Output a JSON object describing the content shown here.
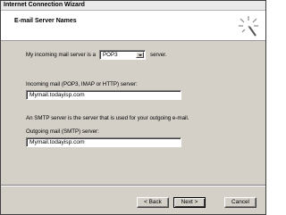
{
  "window": {
    "title": "Internet Connection Wizard"
  },
  "header": {
    "heading": "E-mail Server Names",
    "icon": "wizard-wand-icon"
  },
  "incoming": {
    "prefix_label": "My incoming mail server is a",
    "server_type": "POP3",
    "suffix_label": "server.",
    "field_label": "Incoming mail (POP3, IMAP or HTTP) server:",
    "field_value": "Mymail.todayisp.com"
  },
  "smtp": {
    "info_text": "An SMTP server is the server that is used for your outgoing e-mail.",
    "field_label": "Outgoing mail (SMTP) server:",
    "field_value": "Mymail.todayisp.com"
  },
  "buttons": {
    "back": "< Back",
    "next": "Next >",
    "cancel": "Cancel"
  }
}
